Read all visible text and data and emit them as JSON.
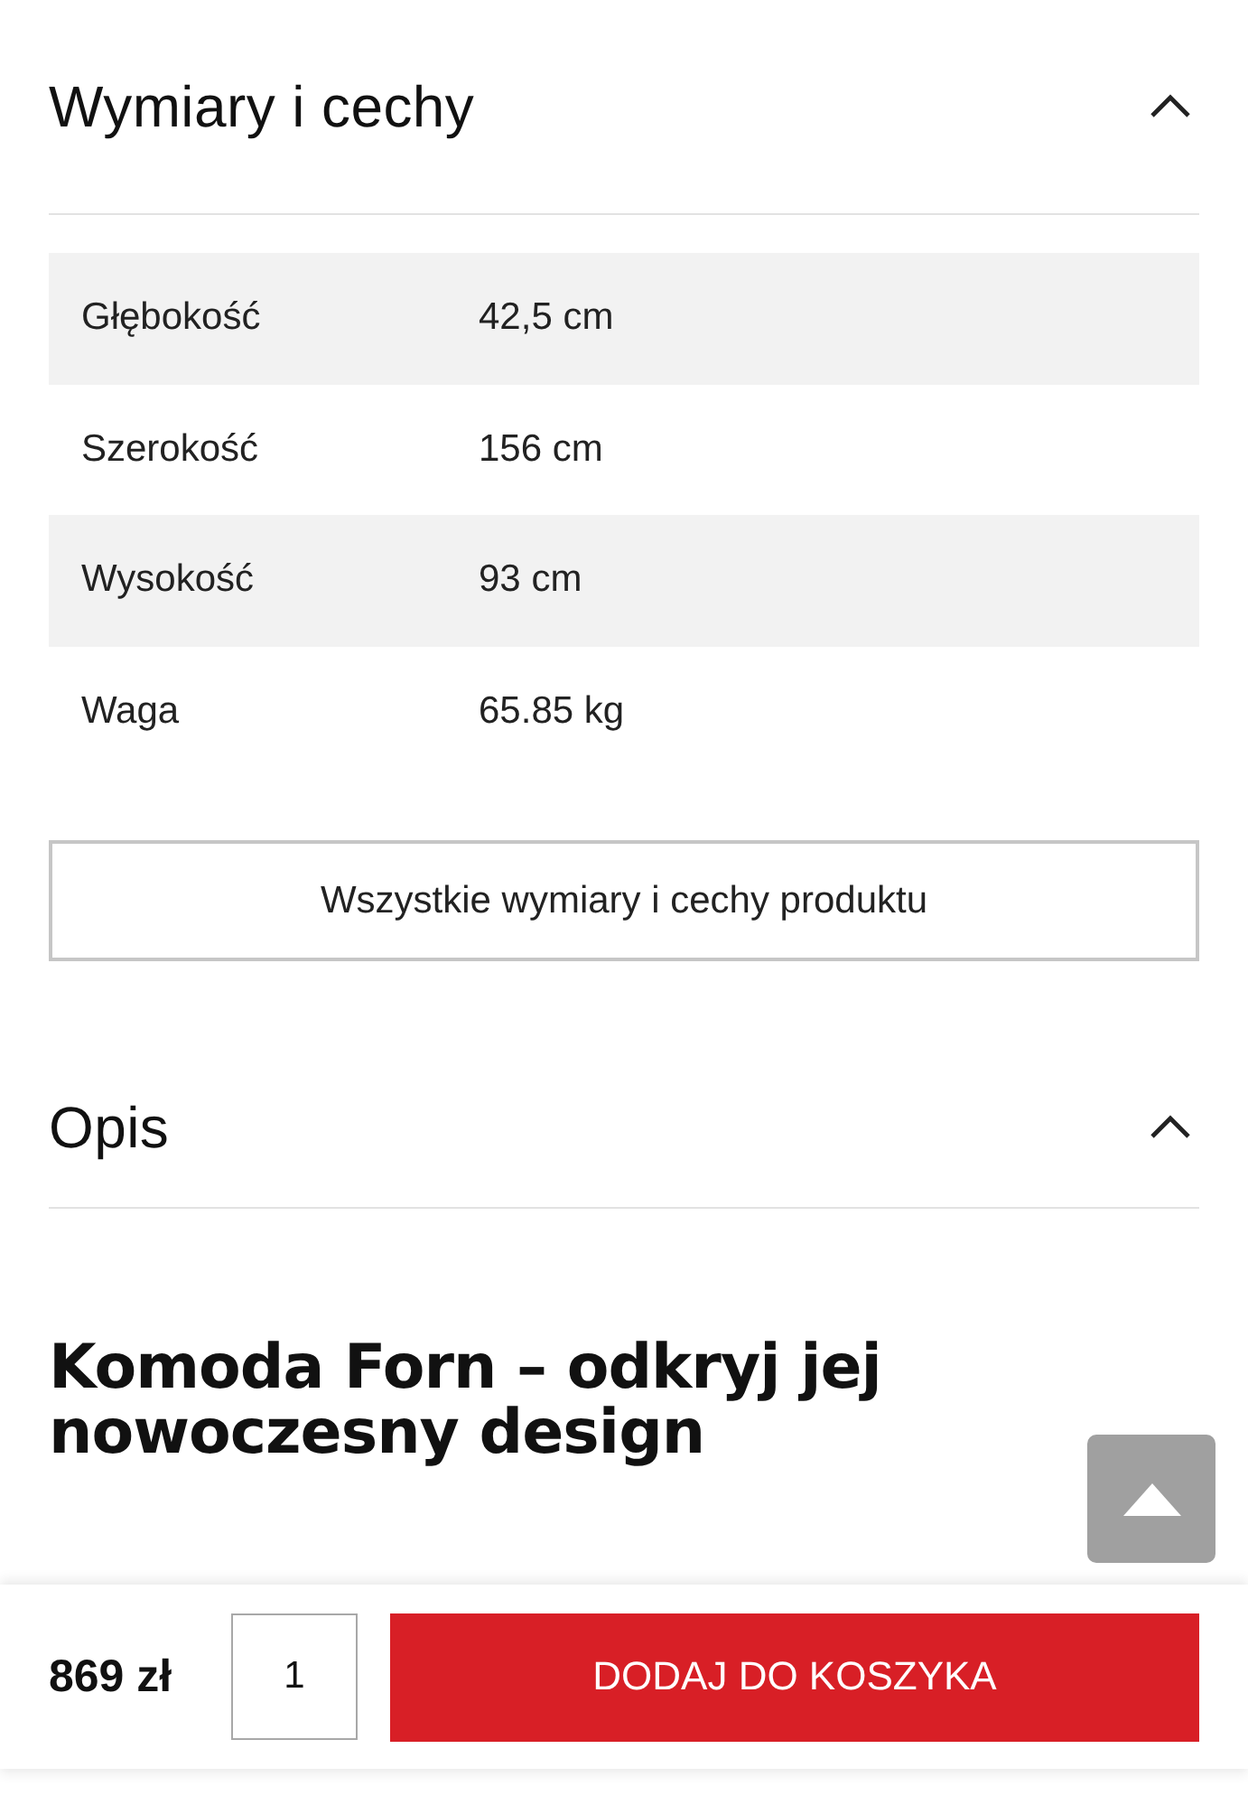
{
  "specs_section": {
    "title": "Wymiary i cechy",
    "expanded": true,
    "rows": [
      {
        "label": "Głębokość",
        "value": "42,5 cm"
      },
      {
        "label": "Szerokość",
        "value": "156 cm"
      },
      {
        "label": "Wysokość",
        "value": "93 cm"
      },
      {
        "label": "Waga",
        "value": "65.85 kg"
      }
    ],
    "all_button": "Wszystkie wymiary i cechy produktu"
  },
  "description_section": {
    "title": "Opis",
    "expanded": true,
    "heading": "Komoda Forn – odkryj jej nowoczesny design"
  },
  "cart_bar": {
    "price": "869 zł",
    "quantity": "1",
    "add_button": "DODAJ DO KOSZYKA"
  }
}
